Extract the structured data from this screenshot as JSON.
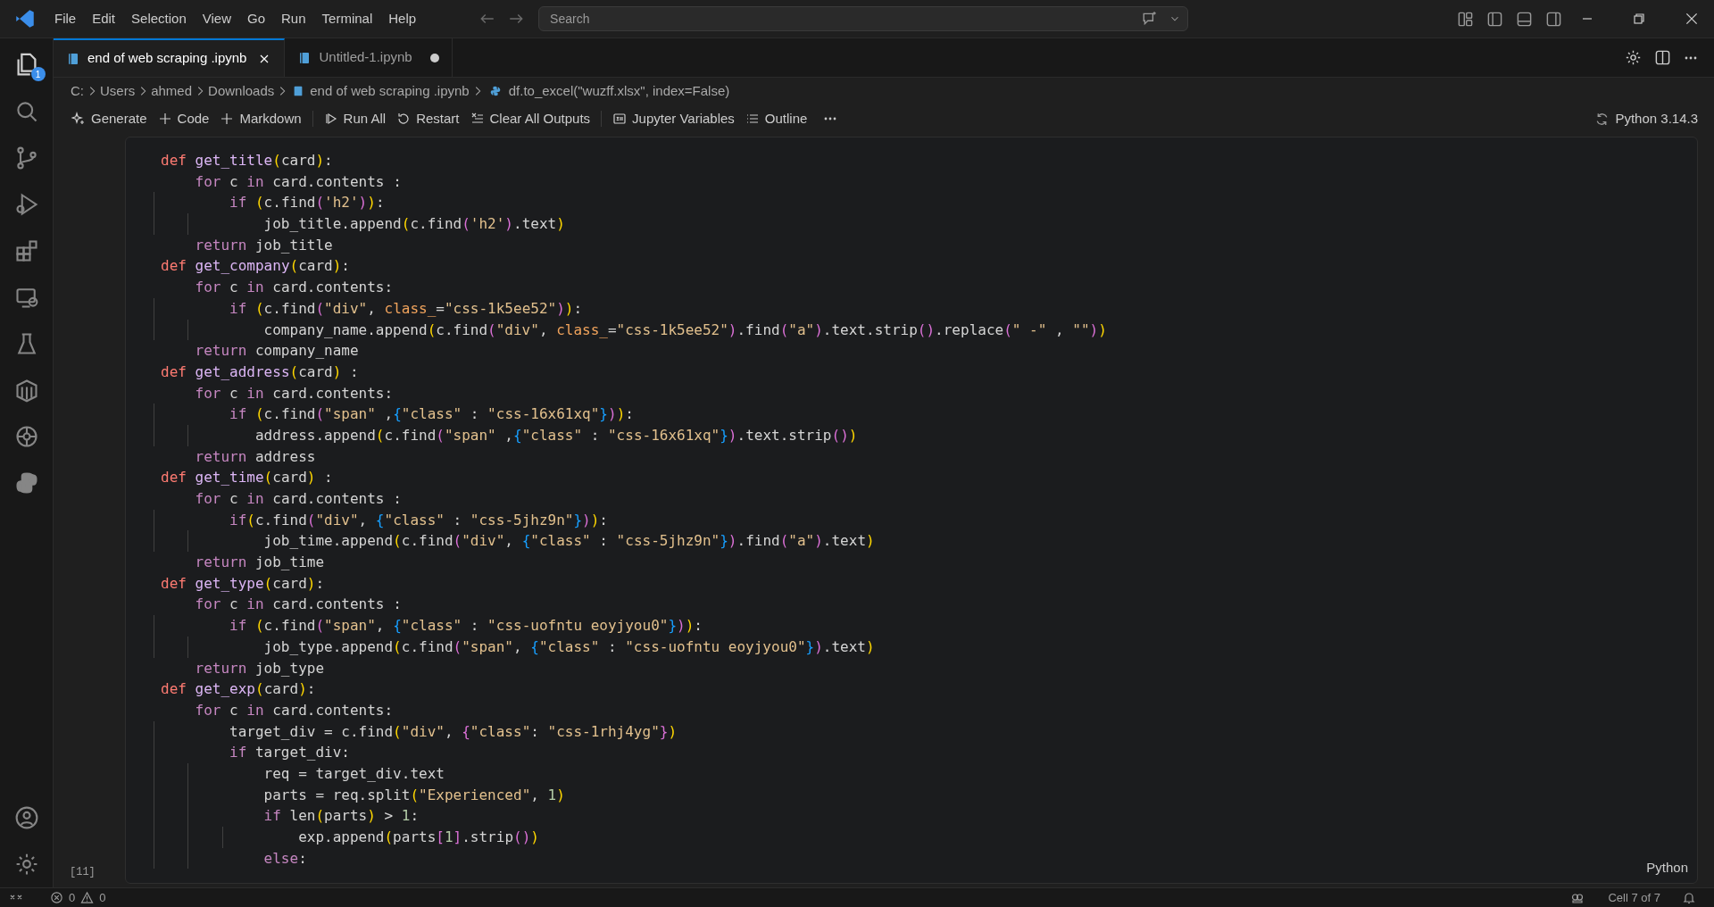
{
  "menu": [
    "File",
    "Edit",
    "Selection",
    "View",
    "Go",
    "Run",
    "Terminal",
    "Help"
  ],
  "search": {
    "placeholder": "Search"
  },
  "activity_bar": {
    "explorer_badge": "1"
  },
  "tabs": [
    {
      "label": "end of web scraping .ipynb",
      "selected": true,
      "dirty": false
    },
    {
      "label": "Untitled-1.ipynb",
      "selected": false,
      "dirty": true
    }
  ],
  "breadcrumbs": [
    "C:",
    "Users",
    "ahmed",
    "Downloads",
    "end of web scraping .ipynb",
    "df.to_excel(\"wuzff.xlsx\", index=False)"
  ],
  "toolbar": [
    {
      "label": "Generate",
      "kind": "sparkle"
    },
    {
      "label": "Code",
      "kind": "plus"
    },
    {
      "label": "Markdown",
      "kind": "plus"
    },
    {
      "label": "Run All",
      "kind": "run",
      "sep": true
    },
    {
      "label": "Restart",
      "kind": "restart"
    },
    {
      "label": "Clear All Outputs",
      "kind": "clear"
    },
    {
      "label": "Jupyter Variables",
      "kind": "vars",
      "sep": true
    },
    {
      "label": "Outline",
      "kind": "list"
    }
  ],
  "kernel": "Python 3.14.3",
  "cell": {
    "execution_count": "[11]",
    "language": "Python",
    "lines": [
      "def get_title(card):",
      "    for c in card.contents :",
      "        if (c.find('h2')):",
      "            job_title.append(c.find('h2').text)",
      "    return job_title",
      "def get_company(card):",
      "    for c in card.contents:",
      "        if (c.find(\"div\", class_=\"css-1k5ee52\")):",
      "            company_name.append(c.find(\"div\", class_=\"css-1k5ee52\").find(\"a\").text.strip().replace(\" -\" , \"\"))",
      "    return company_name",
      "def get_address(card) :",
      "    for c in card.contents:",
      "        if (c.find(\"span\" ,{\"class\" : \"css-16x61xq\"})):",
      "           address.append(c.find(\"span\" ,{\"class\" : \"css-16x61xq\"}).text.strip())",
      "    return address",
      "def get_time(card) :",
      "    for c in card.contents :",
      "        if(c.find(\"div\", {\"class\" : \"css-5jhz9n\"})):",
      "            job_time.append(c.find(\"div\", {\"class\" : \"css-5jhz9n\"}).find(\"a\").text)",
      "    return job_time",
      "def get_type(card):",
      "    for c in card.contents :",
      "        if (c.find(\"span\", {\"class\" : \"css-uofntu eoyjyou0\"})):",
      "            job_type.append(c.find(\"span\", {\"class\" : \"css-uofntu eoyjyou0\"}).text)",
      "    return job_type",
      "def get_exp(card):",
      "    for c in card.contents:",
      "        target_div = c.find(\"div\", {\"class\": \"css-1rhj4yg\"})",
      "        if target_div:",
      "            req = target_div.text",
      "            parts = req.split(\"Experienced\", 1)",
      "            if len(parts) > 1:",
      "                exp.append(parts[1].strip())",
      "            else:"
    ]
  },
  "status_bar": {
    "errors": "0",
    "warnings": "0",
    "cell_position": "Cell 7 of 7"
  }
}
